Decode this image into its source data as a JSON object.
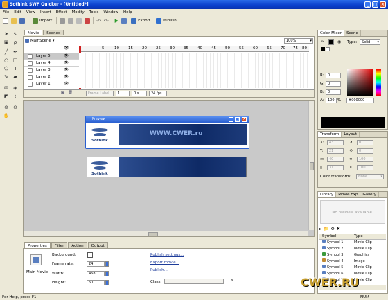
{
  "window": {
    "title": "Sothink SWF Quicker - [Untitled*]"
  },
  "menu": [
    "File",
    "Edit",
    "View",
    "Insert",
    "Effect",
    "Modify",
    "Tools",
    "Window",
    "Help"
  ],
  "toolbar": {
    "import": "Import",
    "export": "Export",
    "publish": "Publish"
  },
  "timeline": {
    "tabs": [
      "Movie",
      "Scenes"
    ],
    "scene": "MainScene",
    "zoom": "100%",
    "ruler": [
      "5",
      "10",
      "15",
      "20",
      "25",
      "30",
      "35",
      "40",
      "45",
      "50",
      "55",
      "60",
      "65",
      "70",
      "75",
      "80",
      "85"
    ],
    "layers": [
      "Layer 5",
      "Layer 4",
      "Layer 3",
      "Layer 2",
      "Layer 1"
    ],
    "footer": {
      "frame_label": "Frame Label",
      "frame": "1",
      "time": "0 s",
      "fps": "24 fps"
    }
  },
  "preview": {
    "title": "Preview",
    "watermark": "WWW.CWER.ru",
    "logo_text": "Sothink"
  },
  "properties": {
    "tabs": [
      "Properties",
      "Filter",
      "Action",
      "Output"
    ],
    "icon_label": "Main Movie",
    "background_label": "Background:",
    "framerate_label": "Frame rate:",
    "framerate": "24",
    "width_label": "Width:",
    "width": "468",
    "height_label": "Height:",
    "height": "60",
    "links": [
      "Publish settings...",
      "Export movie...",
      "Publish..."
    ],
    "class_label": "Class:"
  },
  "color_mixer": {
    "tabs": [
      "Color Mixer",
      "Scene"
    ],
    "type_label": "Type:",
    "type": "Solid",
    "r_label": "R:",
    "r": "0",
    "g_label": "G:",
    "g": "0",
    "b_label": "B:",
    "b": "0",
    "a_label": "A:",
    "a": "100",
    "a_unit": "%",
    "hex": "#000000"
  },
  "transform": {
    "tabs": [
      "Transform",
      "Layout"
    ],
    "x_label": "X:",
    "x": "43",
    "y_label": "Y:",
    "y": "21",
    "w": "40",
    "h": "31",
    "angle1": "0",
    "angle2": "0",
    "scale1": "100",
    "scale2": "100",
    "color_transform_label": "Color transform:",
    "color_transform": "None"
  },
  "library": {
    "tabs": [
      "Library",
      "Movie Exp",
      "Gallery"
    ],
    "preview_text": "No preview available.",
    "columns": [
      "Symbol",
      "Type"
    ],
    "rows": [
      [
        "Symbol 1",
        "Movie Clip"
      ],
      [
        "Symbol 2",
        "Movie Clip"
      ],
      [
        "Symbol 3",
        "Graphics"
      ],
      [
        "Symbol 4",
        "Image"
      ],
      [
        "Symbol 5",
        "Movie Clip"
      ],
      [
        "Symbol 6",
        "Movie Clip"
      ],
      [
        "Symbol 7",
        "Movie Clip"
      ]
    ]
  },
  "status": {
    "text": "For Help, press F1",
    "right": "NUM"
  },
  "watermark": "CWER.RU"
}
